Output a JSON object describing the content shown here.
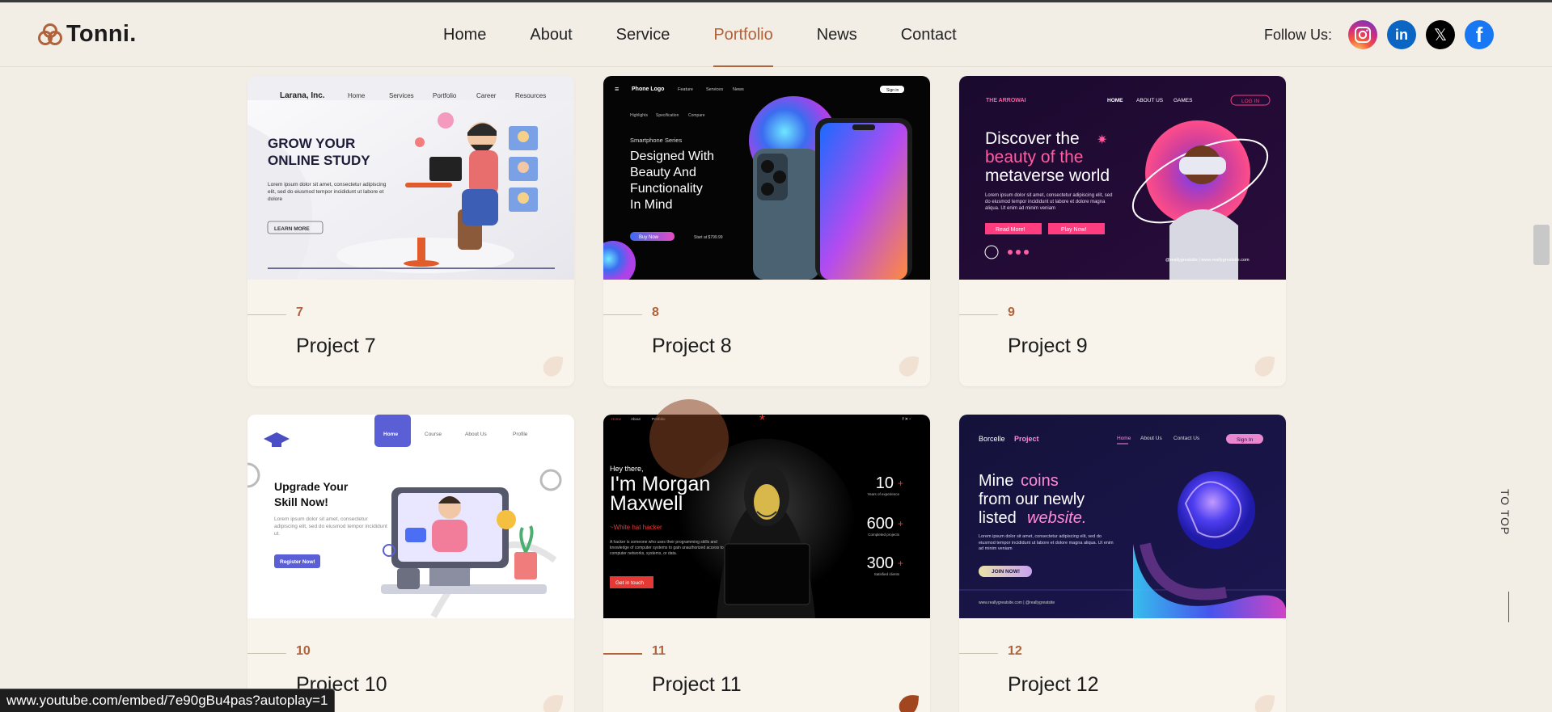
{
  "logo": {
    "text": "Tonni."
  },
  "nav": [
    {
      "label": "Home",
      "active": false
    },
    {
      "label": "About",
      "active": false
    },
    {
      "label": "Service",
      "active": false
    },
    {
      "label": "Portfolio",
      "active": true
    },
    {
      "label": "News",
      "active": false
    },
    {
      "label": "Contact",
      "active": false
    }
  ],
  "follow": {
    "label": "Follow Us:",
    "icons": [
      "instagram-icon",
      "linkedin-icon",
      "x-icon",
      "facebook-icon"
    ]
  },
  "projects": [
    {
      "num": "7",
      "title": "Project 7",
      "thumb": {
        "brand": "Larana, Inc.",
        "nav": [
          "Home",
          "Services",
          "Portfolio",
          "Career",
          "Resources"
        ],
        "headline1": "GROW YOUR",
        "headline2": "ONLINE STUDY",
        "body": "Lorem ipsum dolor sit amet, consectetur adipiscing elit, sed do eiusmod tempor incididunt ut labore et dolore",
        "cta": "LEARN MORE"
      }
    },
    {
      "num": "8",
      "title": "Project 8",
      "thumb": {
        "brand": "Phone Logo",
        "nav": [
          "Feature",
          "Services",
          "News"
        ],
        "signin": "Sign in",
        "tabs": [
          "Highlights",
          "Specification",
          "Compare"
        ],
        "series": "Smartphone Series",
        "headline": [
          "Designed With",
          "Beauty And",
          "Functionality",
          "In Mind"
        ],
        "cta": "Buy Now",
        "price": "Start at $799.99"
      }
    },
    {
      "num": "9",
      "title": "Project 9",
      "thumb": {
        "brand": "THE ARROWAI",
        "nav": [
          "HOME",
          "ABOUT US",
          "GAMES"
        ],
        "login": "LOG IN",
        "headline": [
          "Discover the",
          "beauty of the",
          "metaverse world"
        ],
        "body": "Lorem ipsum dolor sit amet, consectetur adipiscing elit, sed do eiusmod tempor incididunt ut labore et dolore magna aliqua. Ut enim ad minim veniam",
        "cta1": "Read More!",
        "cta2": "Play Now!",
        "footer": "@reallygreatsite | www.reallygreatsite.com"
      }
    },
    {
      "num": "10",
      "title": "Project 10",
      "thumb": {
        "nav": [
          "Home",
          "Course",
          "About Us",
          "Profile"
        ],
        "headline1": "Upgrade Your",
        "headline2": "Skill Now!",
        "body": "Lorem ipsum dolor sit amet, consectetur adipiscing elit, sed do eiusmod tempor incididunt ut.",
        "cta": "Register Now!"
      }
    },
    {
      "num": "11",
      "title": "Project 11",
      "thumb": {
        "nav": [
          "Home",
          "About",
          "Portfolio"
        ],
        "greeting": "Hey there,",
        "name1": "I'm Morgan",
        "name2": "Maxwell",
        "role": "~White hat hacker",
        "body": "A hacker is someone who uses their programming skills and knowledge of computer systems to gain unauthorized access to computer networks, systems, or data.",
        "cta": "Get in touch",
        "stats": [
          {
            "value": "10",
            "label": "Years of experience"
          },
          {
            "value": "600",
            "label": "Completed projects"
          },
          {
            "value": "300",
            "label": "Satisfied clients"
          }
        ]
      }
    },
    {
      "num": "12",
      "title": "Project 12",
      "thumb": {
        "brand1": "Borcelle",
        "brand2": "Project",
        "nav": [
          "Home",
          "About Us",
          "Contact Us"
        ],
        "signin": "Sign In",
        "headline1": "Mine",
        "headline1b": "coins",
        "headline2": "from our newly",
        "headline3": "listed",
        "headline3b": "website.",
        "body": "Lorem ipsum dolor sit amet, consectetur adipiscing elit, sed do eiusmod tempor incididunt ut labore et dolore magna aliqua. Ut enim ad minim veniam",
        "cta": "JOIN NOW!",
        "footer": "www.reallygreatsite.com | @reallygreatsite"
      }
    }
  ],
  "to_top": "TO TOP",
  "status_url": "www.youtube.com/embed/7e90gBu4pas?autoplay=1"
}
